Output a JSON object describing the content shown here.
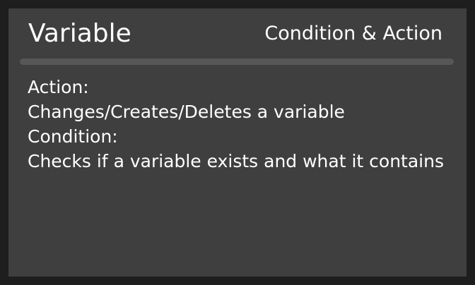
{
  "header": {
    "title": "Variable",
    "category": "Condition & Action"
  },
  "description": {
    "action_label": "Action:",
    "action_text": "Changes/Creates/Deletes a variable",
    "condition_label": "Condition:",
    "condition_text": "Checks if a variable exists and what it contains"
  },
  "colors": {
    "background": "#1e1e1e",
    "panel": "#3f3f3f",
    "divider": "#575757",
    "text": "#ffffff"
  }
}
